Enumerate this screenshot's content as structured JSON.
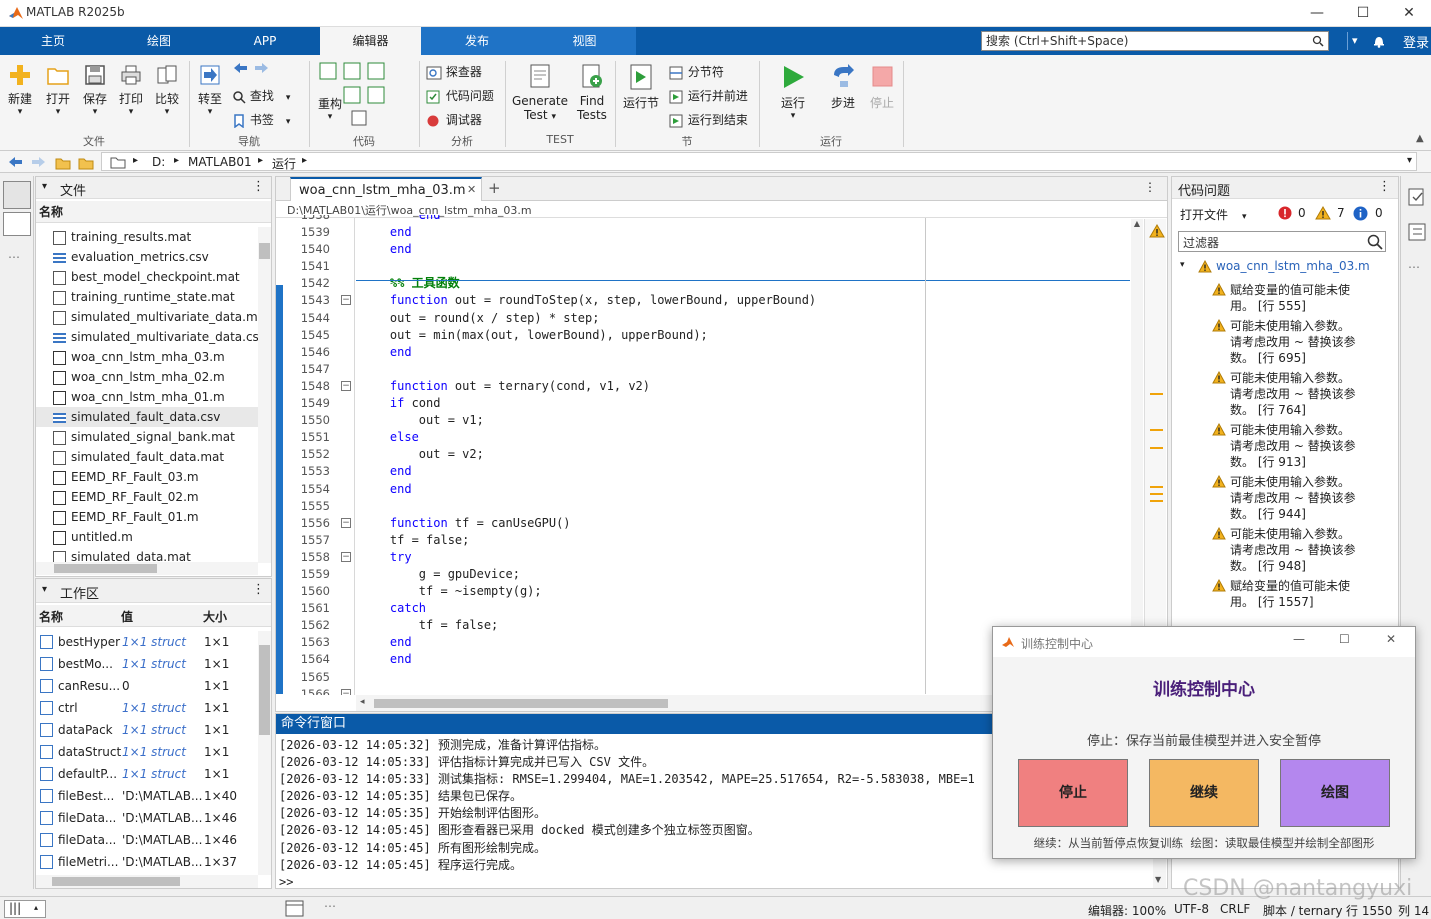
{
  "window": {
    "title": "MATLAB R2025b"
  },
  "tabs": [
    "主页",
    "绘图",
    "APP",
    "编辑器",
    "发布",
    "视图"
  ],
  "active_tab": "编辑器",
  "search": {
    "placeholder": "搜索 (Ctrl+Shift+Space)"
  },
  "login": "登录",
  "ribbon": {
    "file": {
      "new": "新建",
      "open": "打开",
      "save": "保存",
      "print": "打印",
      "compare": "比较",
      "group": "文件"
    },
    "nav": {
      "goto": "转至",
      "find": "查找",
      "bookmark": "书签",
      "group": "导航"
    },
    "code": {
      "refactor": "重构",
      "group": "代码"
    },
    "analyze": {
      "explorer": "探查器",
      "code_issues": "代码问题",
      "debugger": "调试器",
      "group": "分析"
    },
    "test": {
      "generate_1": "Generate",
      "generate_2": "Test",
      "find_1": "Find",
      "find_2": "Tests",
      "group": "TEST"
    },
    "section": {
      "run_section": "运行节",
      "section_break": "分节符",
      "run_advance": "运行并前进",
      "run_to_end": "运行到结束",
      "group": "节"
    },
    "run": {
      "run": "运行",
      "step": "步进",
      "stop": "停止",
      "group": "运行"
    }
  },
  "address": {
    "path": [
      "D:",
      "MATLAB01",
      "运行"
    ]
  },
  "files_panel": {
    "title": "文件",
    "col_name": "名称",
    "items": [
      {
        "name": "training_results.mat",
        "type": "mat"
      },
      {
        "name": "evaluation_metrics.csv",
        "type": "csv"
      },
      {
        "name": "best_model_checkpoint.mat",
        "type": "mat"
      },
      {
        "name": "training_runtime_state.mat",
        "type": "mat"
      },
      {
        "name": "simulated_multivariate_data.mat",
        "type": "mat"
      },
      {
        "name": "simulated_multivariate_data.csv",
        "type": "csv"
      },
      {
        "name": "woa_cnn_lstm_mha_03.m",
        "type": "m"
      },
      {
        "name": "woa_cnn_lstm_mha_02.m",
        "type": "m"
      },
      {
        "name": "woa_cnn_lstm_mha_01.m",
        "type": "m"
      },
      {
        "name": "simulated_fault_data.csv",
        "type": "csv",
        "selected": true
      },
      {
        "name": "simulated_signal_bank.mat",
        "type": "mat"
      },
      {
        "name": "simulated_fault_data.mat",
        "type": "mat"
      },
      {
        "name": "EEMD_RF_Fault_03.m",
        "type": "m"
      },
      {
        "name": "EEMD_RF_Fault_02.m",
        "type": "m"
      },
      {
        "name": "EEMD_RF_Fault_01.m",
        "type": "m"
      },
      {
        "name": "untitled.m",
        "type": "m"
      },
      {
        "name": "simulated_data.mat",
        "type": "mat"
      }
    ]
  },
  "workspace": {
    "title": "工作区",
    "cols": [
      "名称",
      "值",
      "大小"
    ],
    "rows": [
      {
        "name": "bestHyper",
        "value": "1×1 struct",
        "size": "1×1",
        "italic": true
      },
      {
        "name": "bestMo...",
        "value": "1×1 struct",
        "size": "1×1",
        "italic": true
      },
      {
        "name": "canResu...",
        "value": "0",
        "size": "1×1",
        "italic": false
      },
      {
        "name": "ctrl",
        "value": "1×1 struct",
        "size": "1×1",
        "italic": true
      },
      {
        "name": "dataPack",
        "value": "1×1 struct",
        "size": "1×1",
        "italic": true
      },
      {
        "name": "dataStruct",
        "value": "1×1 struct",
        "size": "1×1",
        "italic": true
      },
      {
        "name": "defaultP...",
        "value": "1×1 struct",
        "size": "1×1",
        "italic": true
      },
      {
        "name": "fileBest...",
        "value": "'D:\\MATLAB...",
        "size": "1×40",
        "italic": false
      },
      {
        "name": "fileData...",
        "value": "'D:\\MATLAB...",
        "size": "1×46",
        "italic": false
      },
      {
        "name": "fileData...",
        "value": "'D:\\MATLAB...",
        "size": "1×46",
        "italic": false
      },
      {
        "name": "fileMetri...",
        "value": "'D:\\MATLAB...",
        "size": "1×37",
        "italic": false
      }
    ]
  },
  "editor": {
    "tab": "woa_cnn_lstm_mha_03.m",
    "path": "D:\\MATLAB01\\运行\\woa_cnn_lstm_mha_03.m",
    "lines": [
      {
        "n": "1538",
        "code": "        end"
      },
      {
        "n": "1539",
        "code": "    end"
      },
      {
        "n": "1540",
        "code": "    end"
      },
      {
        "n": "1541",
        "code": ""
      },
      {
        "n": "1542",
        "code": "    %% 工具函数",
        "comment": true
      },
      {
        "n": "1543",
        "code": "    function out = roundToStep(x, step, lowerBound, upperBound)"
      },
      {
        "n": "1544",
        "code": "    out = round(x / step) * step;"
      },
      {
        "n": "1545",
        "code": "    out = min(max(out, lowerBound), upperBound);"
      },
      {
        "n": "1546",
        "code": "    end"
      },
      {
        "n": "1547",
        "code": ""
      },
      {
        "n": "1548",
        "code": "    function out = ternary(cond, v1, v2)"
      },
      {
        "n": "1549",
        "code": "    if cond"
      },
      {
        "n": "1550",
        "code": "        out = v1;"
      },
      {
        "n": "1551",
        "code": "    else"
      },
      {
        "n": "1552",
        "code": "        out = v2;"
      },
      {
        "n": "1553",
        "code": "    end"
      },
      {
        "n": "1554",
        "code": "    end"
      },
      {
        "n": "1555",
        "code": ""
      },
      {
        "n": "1556",
        "code": "    function tf = canUseGPU()"
      },
      {
        "n": "1557",
        "code": "    tf = false;"
      },
      {
        "n": "1558",
        "code": "    try"
      },
      {
        "n": "1559",
        "code": "        g = gpuDevice;"
      },
      {
        "n": "1560",
        "code": "        tf = ~isempty(g);"
      },
      {
        "n": "1561",
        "code": "    catch"
      },
      {
        "n": "1562",
        "code": "        tf = false;"
      },
      {
        "n": "1563",
        "code": "    end"
      },
      {
        "n": "1564",
        "code": "    end"
      },
      {
        "n": "1565",
        "code": ""
      },
      {
        "n": "1566",
        "code": ""
      }
    ]
  },
  "command_window": {
    "title": "命令行窗口",
    "lines": [
      "[2026-03-12 14:05:32] 预测完成，准备计算评估指标。",
      "[2026-03-12 14:05:33] 评估指标计算完成并已写入 CSV 文件。",
      "[2026-03-12 14:05:33] 测试集指标: RMSE=1.299404, MAE=1.203542, MAPE=25.517654, R2=-5.583038, MBE=1",
      "[2026-03-12 14:05:35] 结果包已保存。",
      "[2026-03-12 14:05:35] 开始绘制评估图形。",
      "[2026-03-12 14:05:45] 图形查看器已采用 docked 模式创建多个独立标签页图窗。",
      "[2026-03-12 14:05:45] 所有图形绘制完成。",
      "[2026-03-12 14:05:45] 程序运行完成。"
    ],
    "prompt": ">>"
  },
  "code_issues": {
    "title": "代码问题",
    "scope": "打开文件",
    "errors": "0",
    "warnings": "7",
    "infos": "0",
    "filter_placeholder": "过滤器",
    "file": "woa_cnn_lstm_mha_03.m",
    "items": [
      {
        "l1": "赋给变量的值可能未使",
        "l2": "用。 [行 555]"
      },
      {
        "l1": "可能未使用输入参数。",
        "l2": "请考虑改用 ~ 替换该参",
        "l3": "数。 [行 695]"
      },
      {
        "l1": "可能未使用输入参数。",
        "l2": "请考虑改用 ~ 替换该参",
        "l3": "数。 [行 764]"
      },
      {
        "l1": "可能未使用输入参数。",
        "l2": "请考虑改用 ~ 替换该参",
        "l3": "数。 [行 913]"
      },
      {
        "l1": "可能未使用输入参数。",
        "l2": "请考虑改用 ~ 替换该参",
        "l3": "数。 [行 944]"
      },
      {
        "l1": "可能未使用输入参数。",
        "l2": "请考虑改用 ~ 替换该参",
        "l3": "数。 [行 948]"
      },
      {
        "l1": "赋给变量的值可能未使",
        "l2": "用。 [行 1557]"
      }
    ]
  },
  "dialog": {
    "title": "训练控制中心",
    "heading": "训练控制中心",
    "status": "停止：保存当前最佳模型并进入安全暂停",
    "buttons": [
      {
        "label": "停止",
        "color": "#f08080"
      },
      {
        "label": "继续",
        "color": "#f4b862"
      },
      {
        "label": "绘图",
        "color": "#b487ee"
      }
    ],
    "footer": "继续：从当前暂停点恢复训练  绘图：读取最佳模型并绘制全部图形"
  },
  "status_bar": {
    "zoom": "编辑器: 100%",
    "encoding": "UTF-8",
    "eol": "CRLF",
    "context": "脚本 / ternary",
    "row": "行 1550",
    "col": "列 14"
  },
  "watermark": "CSDN @nantangyuxi",
  "colors": {
    "accent": "#0a5aa8",
    "warning": "#f0a30a",
    "keyword": "#0e00ff",
    "comment": "#028009"
  }
}
